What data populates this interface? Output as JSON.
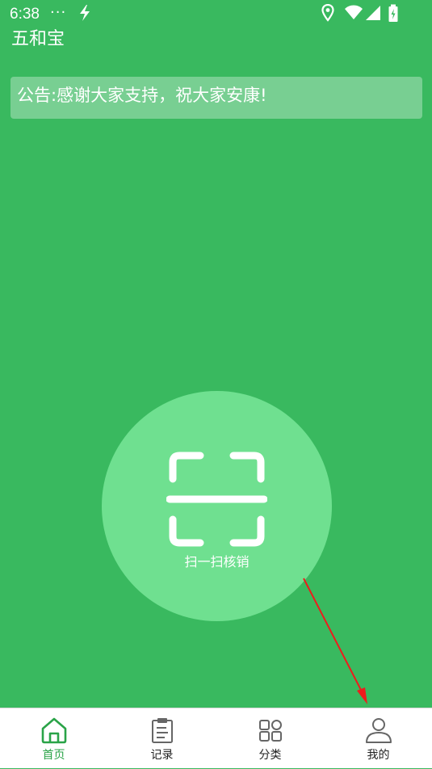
{
  "status_bar": {
    "time": "6:38",
    "dots": "···",
    "icons": [
      "lightning-icon",
      "location-icon",
      "wifi-icon",
      "signal-icon",
      "battery-icon"
    ]
  },
  "app": {
    "title": "五和宝"
  },
  "notice": {
    "text": "公告:感谢大家支持，祝大家安康!"
  },
  "scan": {
    "label": "扫一扫核销",
    "icon": "scan-icon"
  },
  "tabs": [
    {
      "label": "首页",
      "icon": "home-icon",
      "active": true
    },
    {
      "label": "记录",
      "icon": "clipboard-icon",
      "active": false
    },
    {
      "label": "分类",
      "icon": "grid-icon",
      "active": false
    },
    {
      "label": "我的",
      "icon": "user-icon",
      "active": false
    }
  ],
  "colors": {
    "background": "#39b95f",
    "circle": "#6fe090",
    "active_tab": "#2aa348",
    "annotation": "#ee1c1c"
  }
}
